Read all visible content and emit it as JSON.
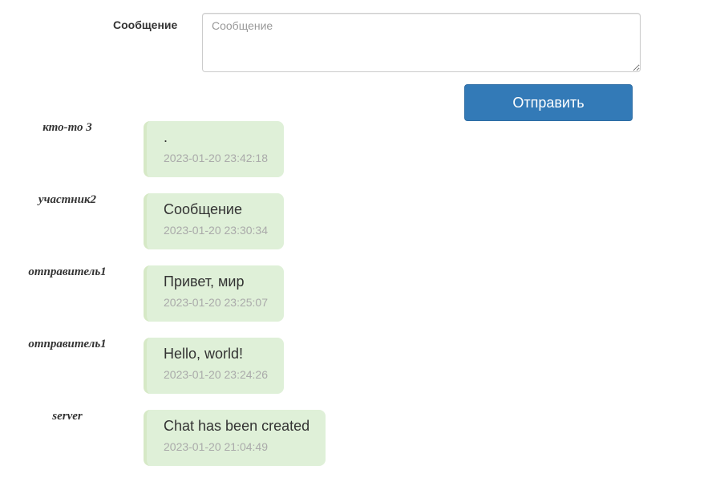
{
  "form": {
    "label": "Сообщение",
    "input_value": "",
    "input_placeholder": "Сообщение",
    "send_label": "Отправить"
  },
  "messages": [
    {
      "sender": "кто-то 3",
      "text": ".",
      "time": "2023-01-20 23:42:18"
    },
    {
      "sender": "участник2",
      "text": "Сообщение",
      "time": "2023-01-20 23:30:34"
    },
    {
      "sender": "отправитель1",
      "text": "Привет, мир",
      "time": "2023-01-20 23:25:07"
    },
    {
      "sender": "отправитель1",
      "text": "Hello, world!",
      "time": "2023-01-20 23:24:26"
    },
    {
      "sender": "server",
      "text": "Chat has been created",
      "time": "2023-01-20 21:04:49"
    }
  ],
  "colors": {
    "bubble_bg": "#dff0d8",
    "button_bg": "#337ab7",
    "timestamp": "#aaaaaa"
  }
}
